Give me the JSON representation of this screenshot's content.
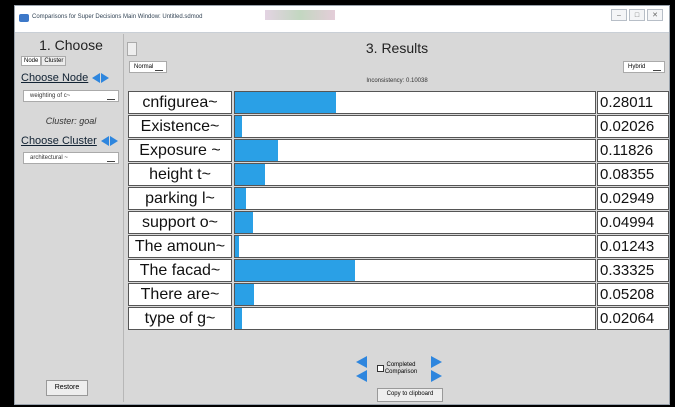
{
  "window": {
    "title": "Comparisons for Super Decisions Main Window: Untitled.sdmod",
    "controls": [
      "–",
      "□",
      "✕"
    ]
  },
  "left": {
    "heading": "1. Choose",
    "tabs": [
      "Node",
      "Cluster"
    ],
    "choose_node_label": "Choose Node",
    "node_dropdown": "weighting of c~",
    "cluster_caption": "Cluster: goal",
    "choose_cluster_label": "Choose Cluster",
    "cluster_dropdown": "architectural ~",
    "restore_label": "Restore"
  },
  "results": {
    "heading": "3. Results",
    "mode_left": "Normal",
    "mode_right": "Hybrid",
    "inconsistency": "Inconsistency: 0.10038",
    "rows": [
      {
        "name": "cnfigurea~",
        "value": "0.28011",
        "fraction": 0.28011
      },
      {
        "name": "Existence~",
        "value": "0.02026",
        "fraction": 0.02026
      },
      {
        "name": "Exposure ~",
        "value": "0.11826",
        "fraction": 0.11826
      },
      {
        "name": "height  t~",
        "value": "0.08355",
        "fraction": 0.08355
      },
      {
        "name": "parking l~",
        "value": "0.02949",
        "fraction": 0.02949
      },
      {
        "name": "support o~",
        "value": "0.04994",
        "fraction": 0.04994
      },
      {
        "name": "The amoun~",
        "value": "0.01243",
        "fraction": 0.01243
      },
      {
        "name": "The facad~",
        "value": "0.33325",
        "fraction": 0.33325
      },
      {
        "name": "There are~",
        "value": "0.05208",
        "fraction": 0.05208
      },
      {
        "name": "type of g~",
        "value": "0.02064",
        "fraction": 0.02064
      }
    ],
    "completed_label": "Completed Comparison",
    "copy_label": "Copy to clipboard"
  },
  "colors": {
    "bar": "#2aa0e6",
    "arrow": "#2e86de"
  }
}
